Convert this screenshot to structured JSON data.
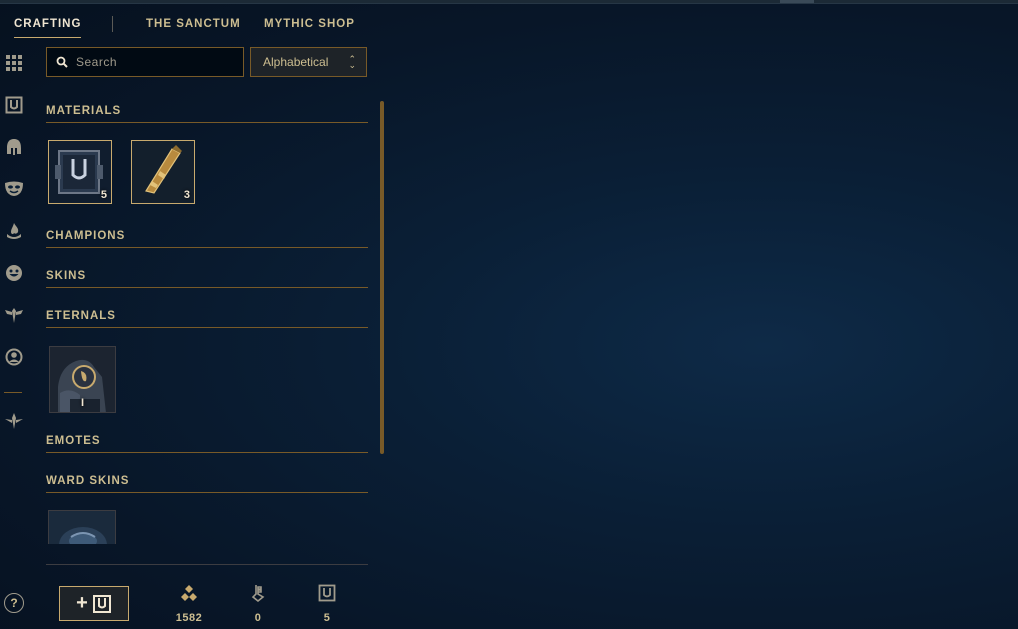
{
  "nav": {
    "tabs": [
      {
        "label": "CRAFTING",
        "active": true
      },
      {
        "label": "THE SANCTUM",
        "active": false
      },
      {
        "label": "MYTHIC SHOP",
        "active": false
      }
    ]
  },
  "rail": {
    "icons": [
      "grid-icon",
      "chest-icon",
      "helmet-icon",
      "mask-icon",
      "flame-icon",
      "smiley-icon",
      "ward-icon",
      "profile-icon",
      "tft-icon"
    ],
    "help_label": "?"
  },
  "search": {
    "placeholder": "Search",
    "value": ""
  },
  "sort": {
    "selected": "Alphabetical"
  },
  "sections": {
    "materials": {
      "title": "MATERIALS",
      "items": [
        {
          "icon": "chest-icon",
          "count": "5"
        },
        {
          "icon": "key-fragment-icon",
          "count": "3"
        }
      ]
    },
    "champions": {
      "title": "CHAMPIONS"
    },
    "skins": {
      "title": "SKINS"
    },
    "eternals": {
      "title": "ETERNALS",
      "items": [
        {
          "icon": "eternal-icon",
          "count": "I"
        }
      ]
    },
    "emotes": {
      "title": "EMOTES"
    },
    "ward_skins": {
      "title": "WARD SKINS",
      "items": [
        {
          "icon": "ward-skin-icon"
        }
      ]
    }
  },
  "bottom": {
    "add_button_label": "+",
    "currencies": [
      {
        "icon": "orange-essence-icon",
        "value": "1582"
      },
      {
        "icon": "key-icon",
        "value": "0"
      },
      {
        "icon": "chest-icon",
        "value": "5"
      }
    ]
  },
  "colors": {
    "gold": "#c8aa6e",
    "gold_dark": "#785a28",
    "text": "#cdbe91",
    "bg": "#0a1f36"
  }
}
